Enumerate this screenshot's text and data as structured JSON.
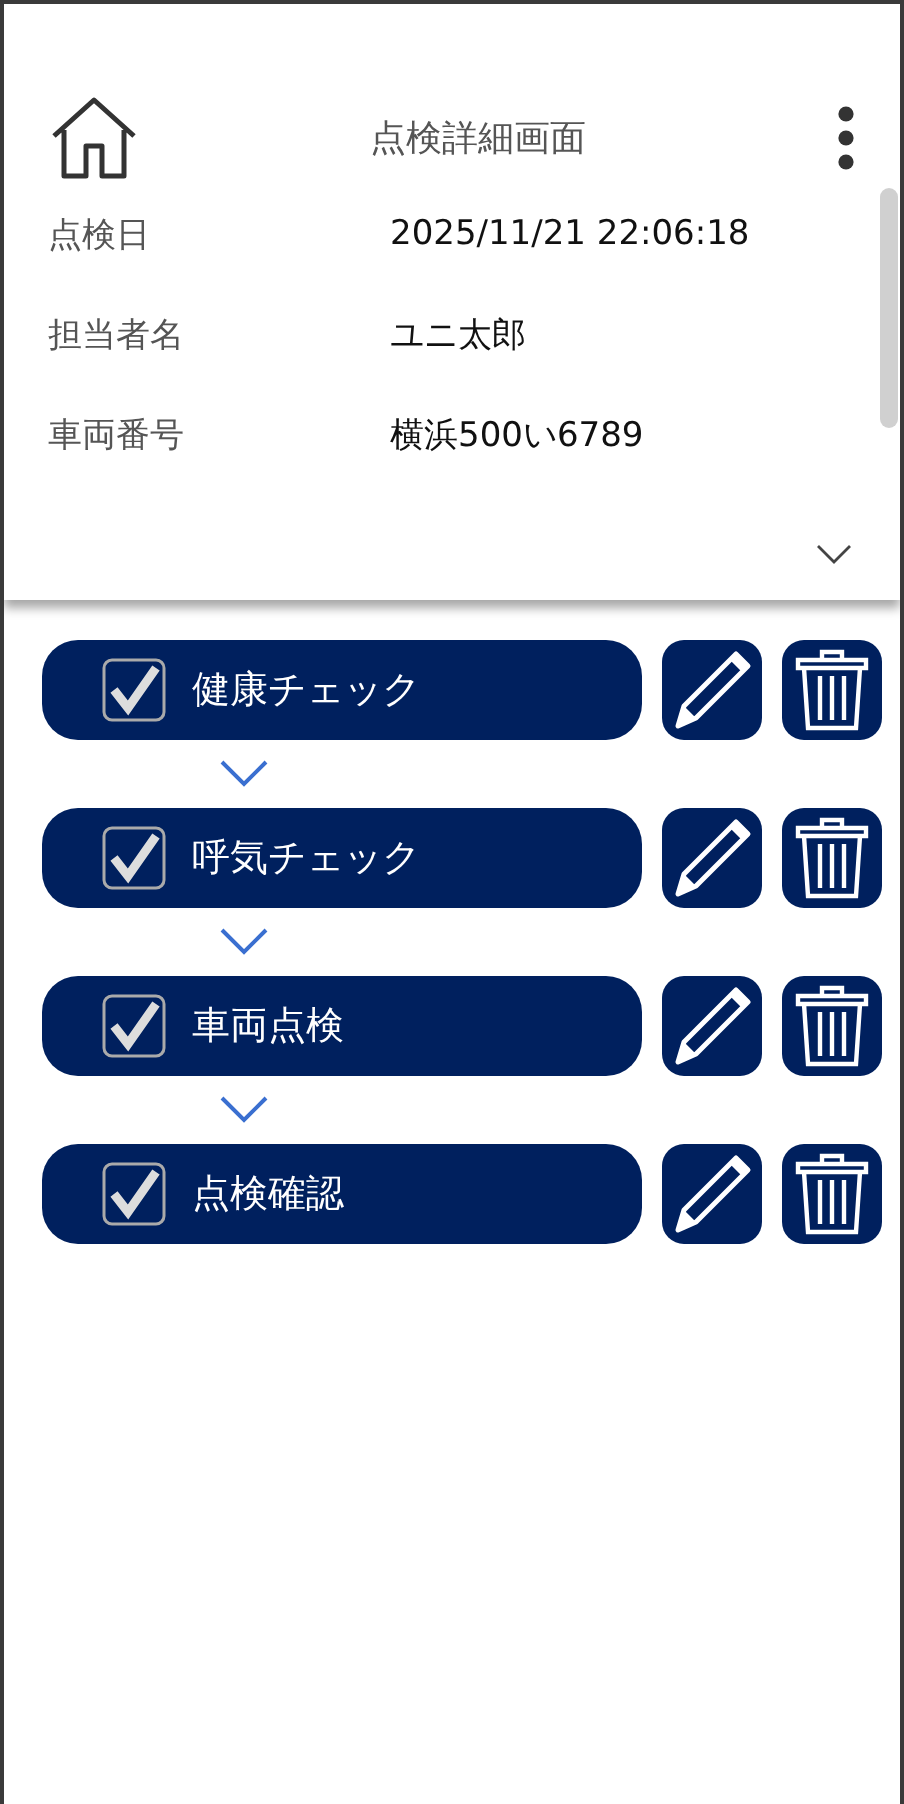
{
  "header": {
    "title": "点検詳細画面"
  },
  "details": [
    {
      "label": "点検日",
      "value": "2025/11/21 22:06:18"
    },
    {
      "label": "担当者名",
      "value": "ユニ太郎"
    },
    {
      "label": "車両番号",
      "value": "横浜500い6789"
    }
  ],
  "steps": [
    {
      "label": "健康チェック",
      "checked": true
    },
    {
      "label": "呼気チェック",
      "checked": true
    },
    {
      "label": "車両点検",
      "checked": true
    },
    {
      "label": "点検確認",
      "checked": true
    }
  ]
}
